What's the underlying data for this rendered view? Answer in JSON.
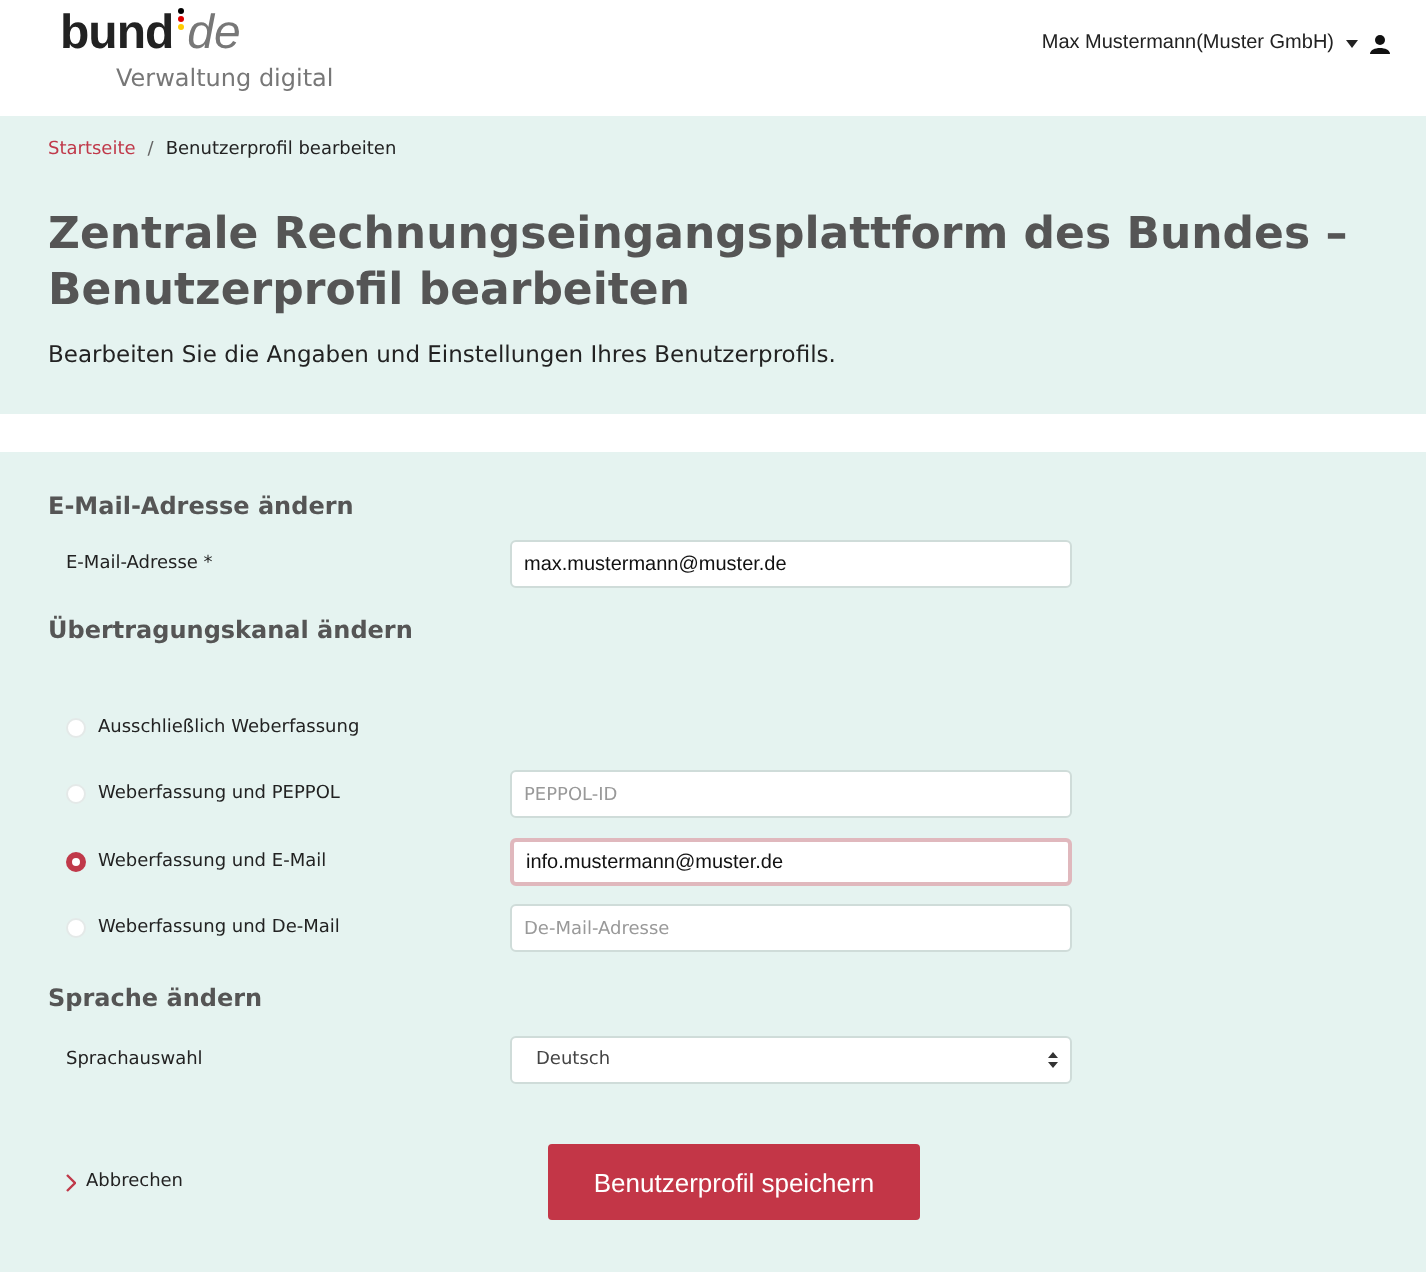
{
  "header": {
    "logo": {
      "word": "bund",
      "suffix": "de",
      "tagline": "Verwaltung digital"
    },
    "user_menu": "Max Mustermann(Muster GmbH)"
  },
  "breadcrumb": [
    {
      "label": "Startseite",
      "kind": "link"
    },
    {
      "label": "/",
      "kind": "separator"
    },
    {
      "label": "Benutzerprofil bearbeiten",
      "kind": "current"
    }
  ],
  "hero": {
    "title": "Zentrale Rechnungseingangsplattform des Bundes – Benutzerprofil bearbeiten",
    "subtitle": "Bearbeiten Sie die Angaben und Einstellungen Ihres Benutzerprofils."
  },
  "email_section": {
    "heading": "E-Mail-Adresse ändern",
    "label": "E-Mail-Adresse *",
    "value": "max.mustermann@muster.de"
  },
  "channel_section": {
    "heading": "Übertragungskanal ändern",
    "options": [
      {
        "label": "Ausschließlich Weberfassung",
        "selected": false
      },
      {
        "label": "Weberfassung und PEPPOL",
        "selected": false,
        "field": {
          "placeholder": "PEPPOL-ID"
        }
      },
      {
        "label": "Weberfassung und E-Mail",
        "selected": true,
        "field": {
          "value": "info.mustermann@muster.de"
        }
      },
      {
        "label": "Weberfassung und De-Mail",
        "selected": false,
        "field": {
          "placeholder": "De-Mail-Adresse"
        }
      }
    ]
  },
  "language_section": {
    "heading": "Sprache ändern",
    "label": "Sprachauswahl",
    "value": "Deutsch"
  },
  "actions": {
    "cancel": "Abbrechen",
    "save": "Benutzerprofil speichern"
  }
}
